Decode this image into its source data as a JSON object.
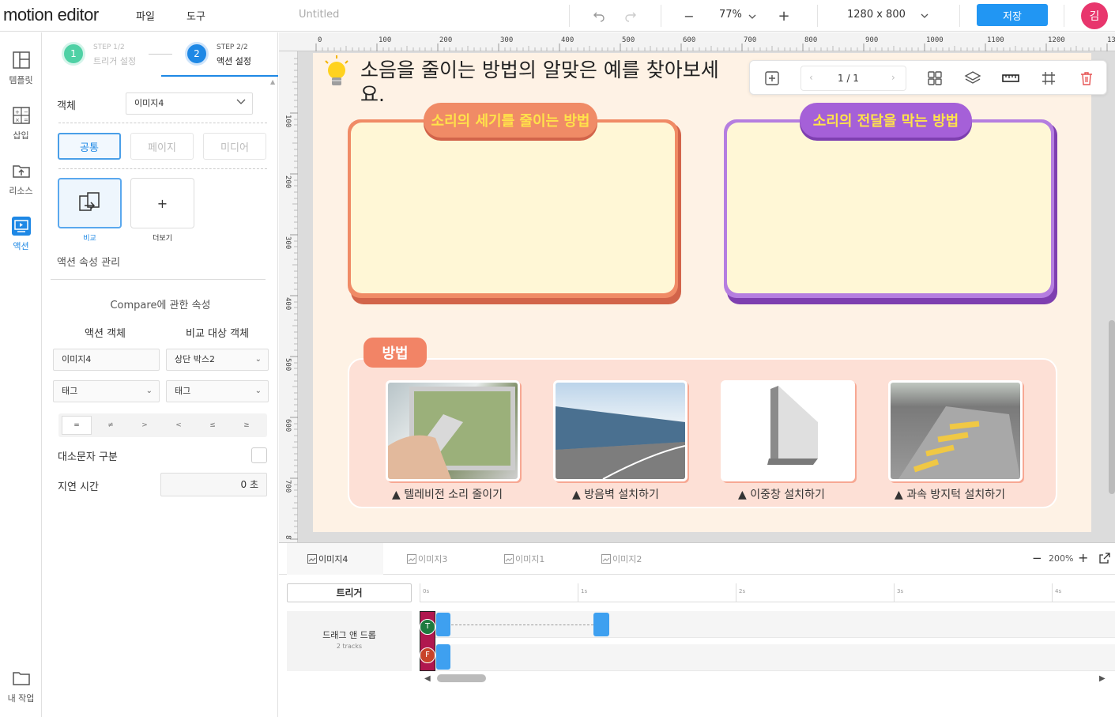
{
  "header": {
    "logo": "motion editor",
    "menus": [
      "파일",
      "도구"
    ],
    "doc_title": "Untitled",
    "zoom": "77%",
    "canvas_size": "1280 x 800",
    "save_label": "저장",
    "avatar_initial": "김"
  },
  "rail": {
    "items": [
      {
        "label": "템플릿",
        "icon": "template-icon"
      },
      {
        "label": "삽입",
        "icon": "insert-icon"
      },
      {
        "label": "리소스",
        "icon": "resource-icon"
      },
      {
        "label": "액션",
        "icon": "action-icon"
      },
      {
        "label": "내 작업",
        "icon": "folder-icon"
      }
    ]
  },
  "panel": {
    "steps": [
      {
        "num": "1",
        "small": "STEP 1/2",
        "label": "트리거 설정"
      },
      {
        "num": "2",
        "small": "STEP 2/2",
        "label": "액션 설정"
      }
    ],
    "object_label": "객체",
    "object_value": "이미지4",
    "tabs": [
      "공통",
      "페이지",
      "미디어"
    ],
    "actions": [
      {
        "label": "비교",
        "icon": "compare-icon"
      },
      {
        "label": "더보기",
        "icon": "plus-icon"
      }
    ],
    "props_title": "액션 속성 관리",
    "compare_title": "Compare에 관한 속성",
    "col_action_object": "액션 객체",
    "col_target_object": "비교 대상 객체",
    "action_object_value": "이미지4",
    "target_object_value": "상단 박스2",
    "tag_left": "태그",
    "tag_right": "태그",
    "operators": [
      "=",
      "≠",
      ">",
      "<",
      "≤",
      "≥"
    ],
    "case_label": "대소문자 구분",
    "delay_label": "지연 시간",
    "delay_value": "0 초"
  },
  "canvas": {
    "ruler_top": [
      "0",
      "100",
      "200",
      "300",
      "400",
      "500",
      "600",
      "700",
      "800",
      "900",
      "1000",
      "1100",
      "1200",
      "13"
    ],
    "ruler_left": [
      "100",
      "200",
      "300",
      "400",
      "500",
      "600",
      "700",
      "8"
    ],
    "question": "소음을 줄이는 방법의 알맞은 예를 찾아보세요.",
    "box_left_title": "소리의 세기를 줄이는 방법",
    "box_right_title": "소리의 전달을 막는 방법",
    "method_tag": "방법",
    "pictures": [
      {
        "caption": "▲ 텔레비전 소리 줄이기"
      },
      {
        "caption": "▲ 방음벽 설치하기"
      },
      {
        "caption": "▲ 이중창 설치하기"
      },
      {
        "caption": "▲ 과속 방지턱 설치하기"
      }
    ],
    "page_indicator": "1 / 1",
    "colors": {
      "left_box": "#e8704f",
      "right_box": "#9b59c9",
      "tag_text": "#ffe24a"
    }
  },
  "timeline": {
    "tabs": [
      "이미지4",
      "이미지3",
      "이미지1",
      "이미지2"
    ],
    "zoom": "200%",
    "trigger_label": "트리거",
    "track_name": "드래그 앤 드롭",
    "track_count": "2 tracks",
    "ticks": [
      "0s",
      "1s",
      "2s",
      "3s",
      "4s"
    ],
    "markers": [
      "T",
      "F"
    ]
  }
}
